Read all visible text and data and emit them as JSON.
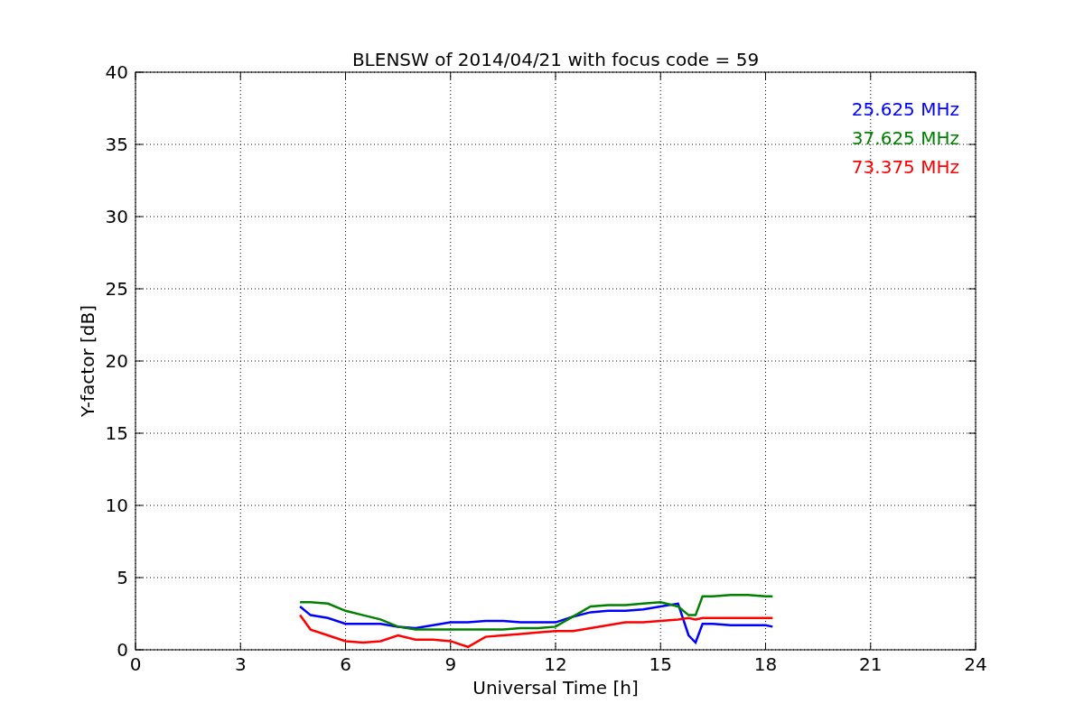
{
  "figure": {
    "chart_data": {
      "type": "line",
      "title": "BLENSW of 2014/04/21 with focus code = 59",
      "xlabel": "Universal Time [h]",
      "ylabel": "Y-factor [dB]",
      "x": [
        4.7,
        5,
        5.5,
        6,
        6.5,
        7,
        7.5,
        8,
        8.5,
        9,
        9.5,
        10,
        10.5,
        11,
        11.5,
        12,
        12.5,
        13,
        13.5,
        14,
        14.5,
        15,
        15.5,
        15.8,
        16,
        16.2,
        16.5,
        17,
        17.5,
        18,
        18.2
      ],
      "series": [
        {
          "name": "25.625 MHz",
          "color": "#0000ff",
          "values": [
            3.0,
            2.4,
            2.2,
            1.8,
            1.8,
            1.8,
            1.6,
            1.5,
            1.7,
            1.9,
            1.9,
            2.0,
            2.0,
            1.9,
            1.9,
            1.9,
            2.3,
            2.6,
            2.7,
            2.7,
            2.8,
            3.0,
            3.2,
            1.0,
            0.5,
            1.8,
            1.8,
            1.7,
            1.7,
            1.7,
            1.6
          ]
        },
        {
          "name": "37.625 MHz",
          "color": "#008000",
          "values": [
            3.3,
            3.3,
            3.2,
            2.7,
            2.4,
            2.1,
            1.6,
            1.4,
            1.4,
            1.4,
            1.4,
            1.4,
            1.4,
            1.5,
            1.5,
            1.6,
            2.3,
            3.0,
            3.1,
            3.1,
            3.2,
            3.3,
            3.0,
            2.4,
            2.4,
            3.7,
            3.7,
            3.8,
            3.8,
            3.7,
            3.7
          ]
        },
        {
          "name": "73.375 MHz",
          "color": "#ff0000",
          "values": [
            2.4,
            1.4,
            1.0,
            0.6,
            0.5,
            0.6,
            1.0,
            0.7,
            0.7,
            0.6,
            0.2,
            0.9,
            1.0,
            1.1,
            1.2,
            1.3,
            1.3,
            1.5,
            1.7,
            1.9,
            1.9,
            2.0,
            2.1,
            2.2,
            2.1,
            2.2,
            2.2,
            2.2,
            2.2,
            2.2,
            2.2
          ]
        }
      ],
      "grid": true,
      "xlim": [
        0,
        24
      ],
      "ylim": [
        0,
        40
      ],
      "xticks": [
        0,
        3,
        6,
        9,
        12,
        15,
        18,
        21,
        24
      ],
      "yticks": [
        0,
        5,
        10,
        15,
        20,
        25,
        30,
        35,
        40
      ]
    }
  }
}
